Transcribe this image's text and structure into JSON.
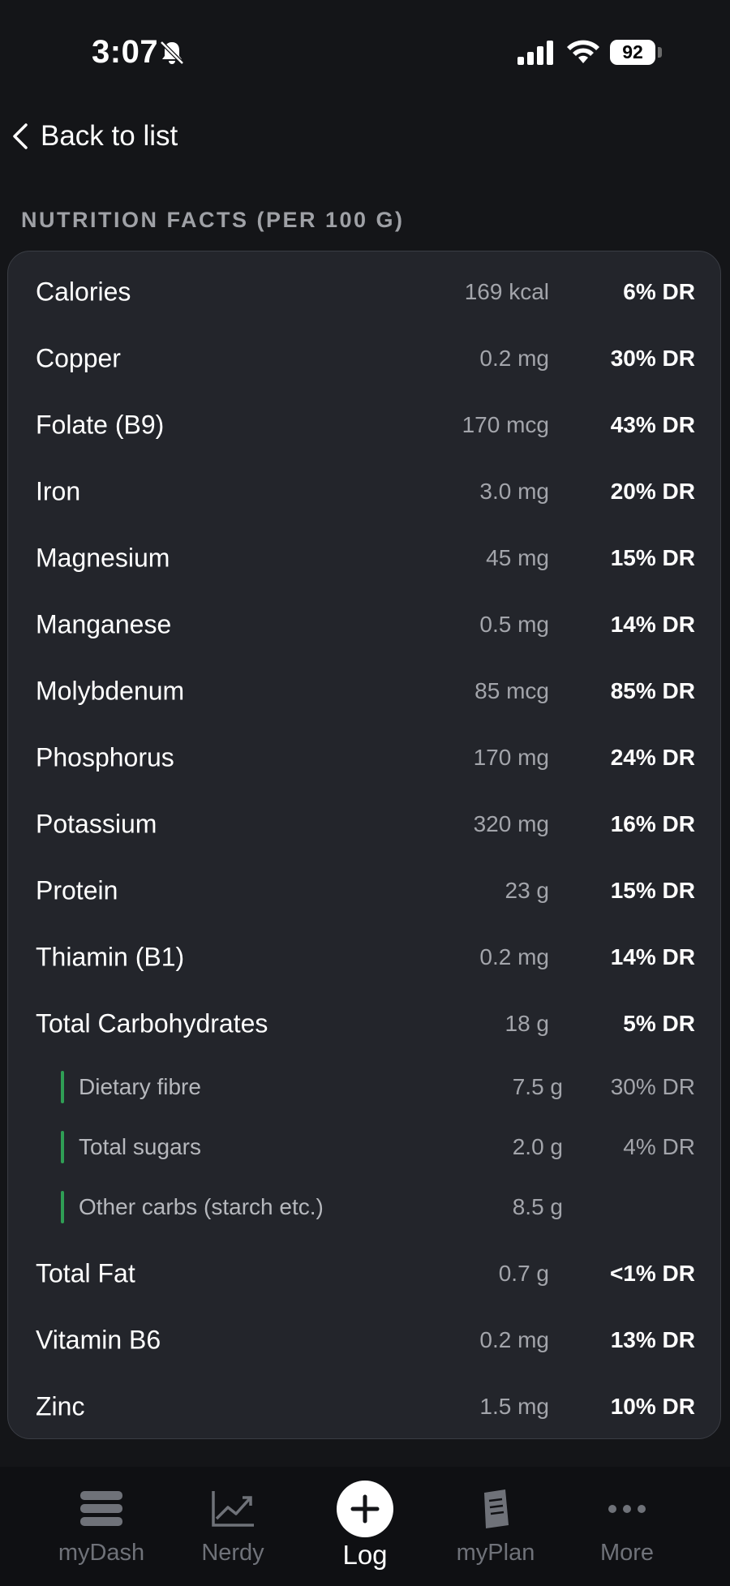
{
  "status_bar": {
    "time": "3:07",
    "battery": "92",
    "icons": [
      "bell-slash-icon",
      "signal-icon",
      "wifi-icon",
      "battery-icon"
    ]
  },
  "navigation": {
    "back_label": "Back to list",
    "back_icon": "chevron-left-icon"
  },
  "section": {
    "title": "NUTRITION FACTS (PER 100 G)"
  },
  "nutrients": [
    {
      "name": "Calories",
      "amount": "169 kcal",
      "dr": "6% DR"
    },
    {
      "name": "Copper",
      "amount": "0.2 mg",
      "dr": "30% DR"
    },
    {
      "name": "Folate (B9)",
      "amount": "170 mcg",
      "dr": "43% DR"
    },
    {
      "name": "Iron",
      "amount": "3.0 mg",
      "dr": "20% DR"
    },
    {
      "name": "Magnesium",
      "amount": "45 mg",
      "dr": "15% DR"
    },
    {
      "name": "Manganese",
      "amount": "0.5 mg",
      "dr": "14% DR"
    },
    {
      "name": "Molybdenum",
      "amount": "85 mcg",
      "dr": "85% DR"
    },
    {
      "name": "Phosphorus",
      "amount": "170 mg",
      "dr": "24% DR"
    },
    {
      "name": "Potassium",
      "amount": "320 mg",
      "dr": "16% DR"
    },
    {
      "name": "Protein",
      "amount": "23 g",
      "dr": "15% DR"
    },
    {
      "name": "Thiamin (B1)",
      "amount": "0.2 mg",
      "dr": "14% DR"
    },
    {
      "name": "Total Carbohydrates",
      "amount": "18 g",
      "dr": "5% DR"
    }
  ],
  "carb_breakdown": [
    {
      "name": "Dietary fibre",
      "amount": "7.5 g",
      "dr": "30% DR"
    },
    {
      "name": "Total sugars",
      "amount": "2.0 g",
      "dr": "4% DR"
    },
    {
      "name": "Other carbs (starch etc.)",
      "amount": "8.5 g",
      "dr": ""
    }
  ],
  "nutrients_after": [
    {
      "name": "Total Fat",
      "amount": "0.7 g",
      "dr": "<1% DR"
    },
    {
      "name": "Vitamin B6",
      "amount": "0.2 mg",
      "dr": "13% DR"
    },
    {
      "name": "Zinc",
      "amount": "1.5 mg",
      "dr": "10% DR"
    }
  ],
  "tabbar": {
    "accent": "#2f9e55",
    "tabs": [
      {
        "label": "myDash",
        "icon": "hamburger-stack-icon"
      },
      {
        "label": "Nerdy",
        "icon": "line-chart-icon"
      },
      {
        "label": "Log",
        "icon": "plus-circle-icon",
        "active": true
      },
      {
        "label": "myPlan",
        "icon": "document-icon"
      },
      {
        "label": "More",
        "icon": "ellipsis-icon"
      }
    ]
  }
}
